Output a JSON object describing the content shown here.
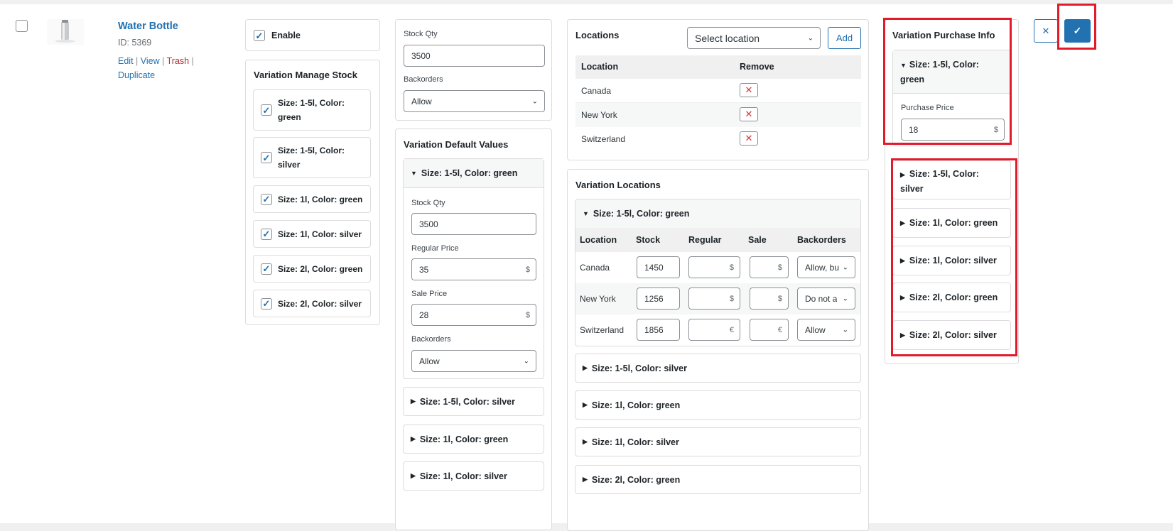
{
  "product": {
    "name": "Water Bottle",
    "id_text": "ID: 5369",
    "actions": [
      "Edit",
      "View",
      "Trash",
      "Duplicate"
    ]
  },
  "enable": {
    "label": "Enable",
    "checked": true
  },
  "manage_stock": {
    "title": "Variation Manage Stock",
    "items": [
      {
        "line1": "Size: 1-5l, Color:",
        "line2": "green"
      },
      {
        "line1": "Size: 1-5l, Color:",
        "line2": "silver"
      },
      {
        "line1": "Size: 1l, Color: green",
        "line2": ""
      },
      {
        "line1": "Size: 1l, Color: silver",
        "line2": ""
      },
      {
        "line1": "Size: 2l, Color: green",
        "line2": ""
      },
      {
        "line1": "Size: 2l, Color: silver",
        "line2": ""
      }
    ]
  },
  "stock": {
    "qty_label": "Stock Qty",
    "qty_value": "3500",
    "backorders_label": "Backorders",
    "backorders_value": "Allow"
  },
  "default_values": {
    "title": "Variation Default Values",
    "open_label": "Size: 1-5l, Color: green",
    "stock_qty_label": "Stock Qty",
    "stock_qty_value": "3500",
    "regular_label": "Regular Price",
    "regular_value": "35",
    "sale_label": "Sale Price",
    "sale_value": "28",
    "backorders_label": "Backorders",
    "backorders_value": "Allow",
    "currency": "$",
    "collapsed": [
      "Size: 1-5l, Color: silver",
      "Size: 1l, Color: green",
      "Size: 1l, Color: silver"
    ]
  },
  "locations": {
    "title": "Locations",
    "select_placeholder": "Select location",
    "add_label": "Add",
    "col_location": "Location",
    "col_remove": "Remove",
    "rows": [
      "Canada",
      "New York",
      "Switzerland"
    ]
  },
  "variation_locations": {
    "title": "Variation Locations",
    "open_label": "Size: 1-5l, Color: green",
    "cols": [
      "Location",
      "Stock",
      "Regular",
      "Sale",
      "Backorders"
    ],
    "rows": [
      {
        "location": "Canada",
        "stock": "1450",
        "cur": "$",
        "backorders": "Allow, bu"
      },
      {
        "location": "New York",
        "stock": "1256",
        "cur": "$",
        "backorders": "Do not a"
      },
      {
        "location": "Switzerland",
        "stock": "1856",
        "cur": "€",
        "backorders": "Allow"
      }
    ],
    "collapsed": [
      "Size: 1-5l, Color: silver",
      "Size: 1l, Color: green",
      "Size: 1l, Color: silver",
      "Size: 2l, Color: green"
    ]
  },
  "purchase": {
    "title": "Variation Purchase Info",
    "open_line1": "Size: 1-5l, Color:",
    "open_line2": "green",
    "price_label": "Purchase Price",
    "price_value": "18",
    "currency": "$",
    "collapsed": [
      {
        "line1": "Size: 1-5l, Color:",
        "line2": "silver"
      },
      {
        "line1": "Size: 1l, Color: green",
        "line2": ""
      },
      {
        "line1": "Size: 1l, Color: silver",
        "line2": ""
      },
      {
        "line1": "Size: 2l, Color: green",
        "line2": ""
      },
      {
        "line1": "Size: 2l, Color: silver",
        "line2": ""
      }
    ]
  },
  "buttons": {
    "cancel_symbol": "✕",
    "save_symbol": "✓"
  },
  "colors": {
    "accent": "#2271b1",
    "highlight": "#e21b2b",
    "danger": "#d63638"
  }
}
